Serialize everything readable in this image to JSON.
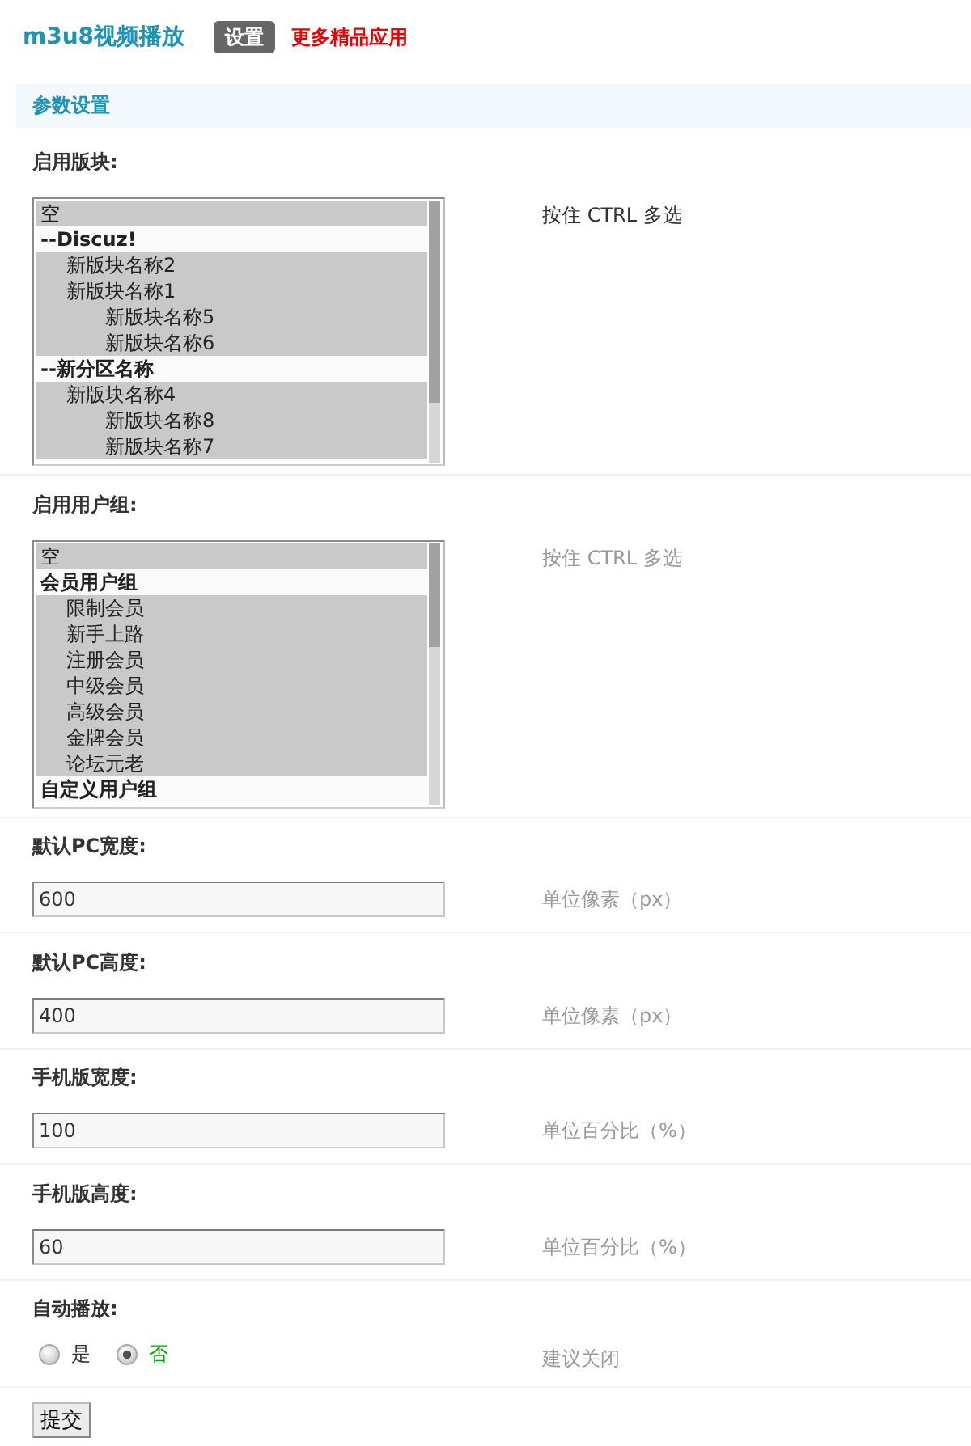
{
  "header": {
    "title": "m3u8视频播放",
    "tabs": [
      {
        "label": "设置",
        "selected": true
      }
    ],
    "more_link": "更多精品应用"
  },
  "section_title": "参数设置",
  "settings": [
    {
      "kind": "multiselect",
      "label": "启用版块:",
      "hint": "按住 CTRL 多选",
      "hovered": true,
      "options": [
        {
          "kind": "option",
          "text": "空",
          "selected": true
        },
        {
          "kind": "group",
          "text": "--Discuz!",
          "children": [
            {
              "kind": "option",
              "text": "新版块名称2",
              "selected": true
            },
            {
              "kind": "option",
              "text": "新版块名称1",
              "selected": true,
              "children": [
                {
                  "kind": "option",
                  "text": "新版块名称5",
                  "selected": true
                },
                {
                  "kind": "option",
                  "text": "新版块名称6",
                  "selected": true
                }
              ]
            }
          ]
        },
        {
          "kind": "group",
          "text": "--新分区名称",
          "children": [
            {
              "kind": "option",
              "text": "新版块名称4",
              "selected": true,
              "children": [
                {
                  "kind": "option",
                  "text": "新版块名称8",
                  "selected": true
                },
                {
                  "kind": "option",
                  "text": "新版块名称7",
                  "selected": true
                }
              ]
            }
          ]
        }
      ]
    },
    {
      "kind": "multiselect",
      "label": "启用用户组:",
      "hint": "按住 CTRL 多选",
      "hovered": false,
      "options": [
        {
          "kind": "option",
          "text": "空",
          "selected": true
        },
        {
          "kind": "group",
          "text": "会员用户组",
          "children": [
            {
              "kind": "option",
              "text": "限制会员",
              "selected": true
            },
            {
              "kind": "option",
              "text": "新手上路",
              "selected": true
            },
            {
              "kind": "option",
              "text": "注册会员",
              "selected": true
            },
            {
              "kind": "option",
              "text": "中级会员",
              "selected": true
            },
            {
              "kind": "option",
              "text": "高级会员",
              "selected": true
            },
            {
              "kind": "option",
              "text": "金牌会员",
              "selected": true
            },
            {
              "kind": "option",
              "text": "论坛元老",
              "selected": true
            }
          ]
        },
        {
          "kind": "group",
          "text": "自定义用户组"
        }
      ]
    },
    {
      "kind": "text",
      "label": "默认PC宽度:",
      "value": "600",
      "hint": "单位像素（px）",
      "hovered": false
    },
    {
      "kind": "text",
      "label": "默认PC高度:",
      "value": "400",
      "hint": "单位像素（px）",
      "hovered": false
    },
    {
      "kind": "text",
      "label": "手机版宽度:",
      "value": "100",
      "hint": "单位百分比（%）",
      "hovered": false
    },
    {
      "kind": "text",
      "label": "手机版高度:",
      "value": "60",
      "hint": "单位百分比（%）",
      "hovered": false
    },
    {
      "kind": "radio",
      "label": "自动播放:",
      "choices": [
        {
          "label": "是",
          "selected": false
        },
        {
          "label": "否",
          "selected": true
        }
      ],
      "hint": "建议关闭",
      "hovered": false
    }
  ],
  "submit": "提交"
}
